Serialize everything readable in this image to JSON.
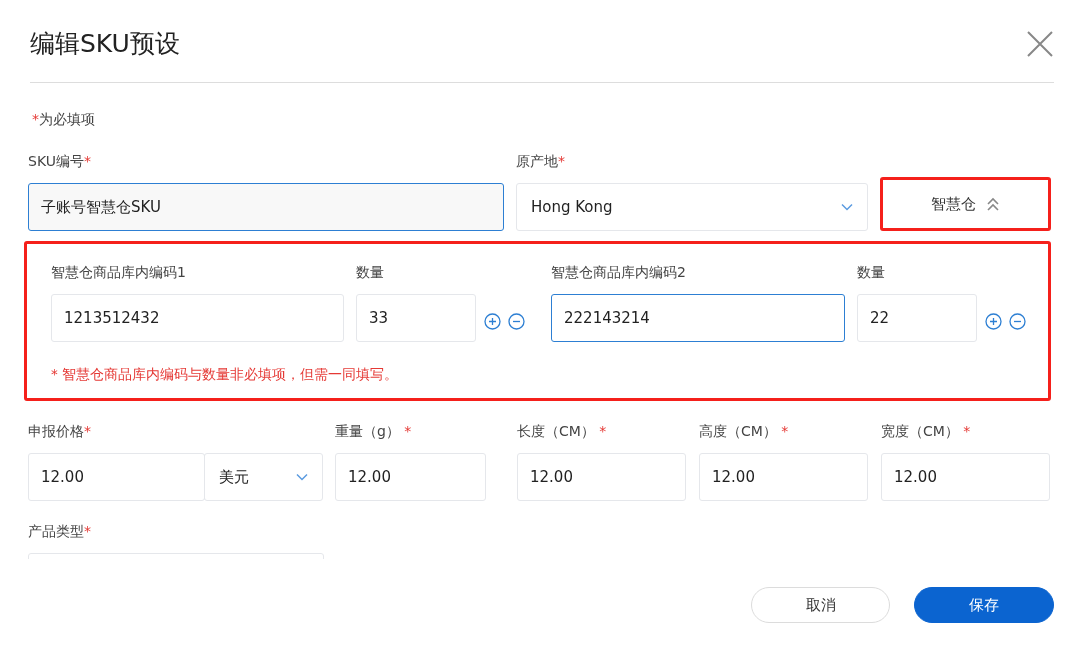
{
  "dialog": {
    "title": "编辑SKU预设"
  },
  "required_note": {
    "mark": "*",
    "text": "为必填项"
  },
  "sku": {
    "label": "SKU编号",
    "mark": "*",
    "value": "子账号智慧仓SKU",
    "focused": true
  },
  "origin": {
    "label": "原产地",
    "mark": "*",
    "value": "Hong Kong"
  },
  "smart_toggle": {
    "label": "智慧仓",
    "expanded": true
  },
  "smart_rows": [
    {
      "code_label": "智慧仓商品库内编码1",
      "code": "1213512432",
      "focused": false,
      "qty_label": "数量",
      "qty": "33"
    },
    {
      "code_label": "智慧仓商品库内编码2",
      "code": "222143214",
      "focused": true,
      "qty_label": "数量",
      "qty": "22"
    }
  ],
  "smart_note": "* 智慧仓商品库内编码与数量非必填项，但需一同填写。",
  "price": {
    "label": "申报价格",
    "mark": "*",
    "value": "12.00",
    "currency": "美元"
  },
  "measures": [
    {
      "label": "重量（g）",
      "mark": " *",
      "value": "12.00"
    },
    {
      "label": "长度（CM）",
      "mark": " *",
      "value": "12.00"
    },
    {
      "label": "高度（CM）",
      "mark": " *",
      "value": "12.00"
    },
    {
      "label": "宽度（CM）",
      "mark": " *",
      "value": "12.00"
    }
  ],
  "product_type": {
    "label": "产品类型",
    "mark": "*"
  },
  "buttons": [
    {
      "label": "取消",
      "kind": "secondary"
    },
    {
      "label": "保存",
      "kind": "primary"
    }
  ]
}
